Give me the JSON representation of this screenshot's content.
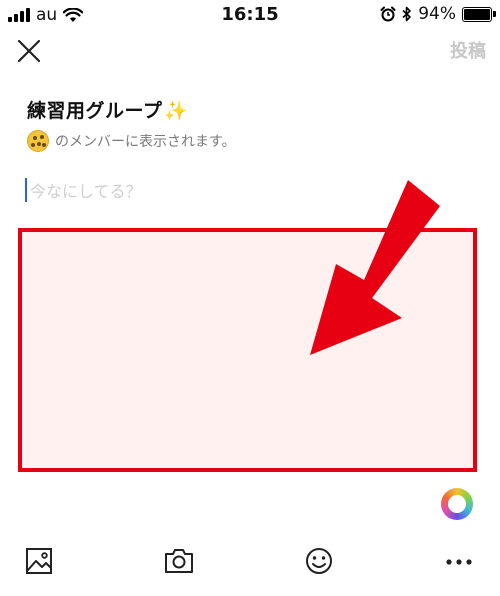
{
  "status_bar": {
    "carrier": "au",
    "time": "16:15",
    "battery_text": "94%"
  },
  "header": {
    "post_label": "投稿"
  },
  "group": {
    "name": "練習用グループ",
    "sparkle": "✨",
    "member_notice": "のメンバーに表示されます。"
  },
  "composer": {
    "value": "",
    "placeholder": "今なにしてる？"
  },
  "colors": {
    "highlight_border": "#e60012",
    "highlight_fill": "#fff1f0",
    "arrow": "#e60012",
    "caret": "#2a63e8",
    "post_disabled": "#c7c7c7"
  },
  "toolbar": {
    "icons": [
      "image-icon",
      "camera-icon",
      "emoji-icon",
      "more-icon"
    ]
  }
}
